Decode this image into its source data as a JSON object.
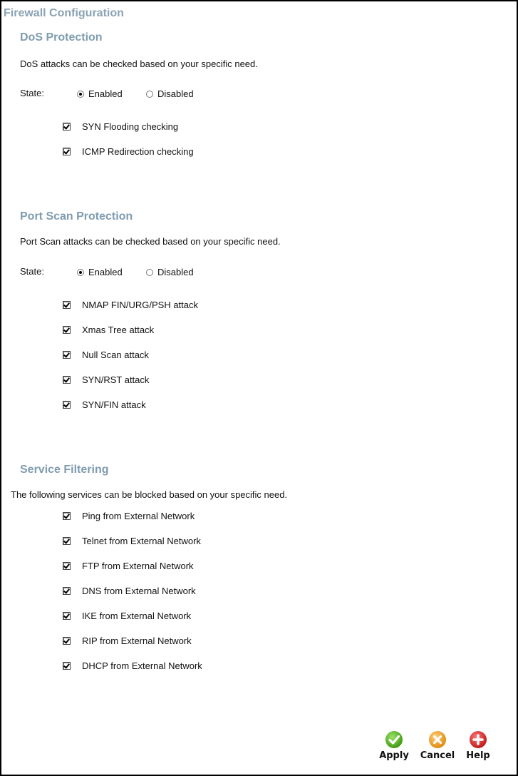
{
  "page_title": "Firewall Configuration",
  "dos": {
    "title": "DoS Protection",
    "description": "DoS attacks can be checked based on your specific need.",
    "state_label": "State:",
    "enabled_label": "Enabled",
    "disabled_label": "Disabled",
    "state": "Enabled",
    "items": [
      {
        "label": "SYN Flooding checking",
        "checked": true
      },
      {
        "label": "ICMP Redirection checking",
        "checked": true
      }
    ]
  },
  "portscan": {
    "title": "Port Scan Protection",
    "description": "Port Scan attacks can be checked based on your specific need.",
    "state_label": "State:",
    "enabled_label": "Enabled",
    "disabled_label": "Disabled",
    "state": "Enabled",
    "items": [
      {
        "label": "NMAP FIN/URG/PSH attack",
        "checked": true
      },
      {
        "label": "Xmas Tree attack",
        "checked": true
      },
      {
        "label": "Null Scan attack",
        "checked": true
      },
      {
        "label": "SYN/RST attack",
        "checked": true
      },
      {
        "label": "SYN/FIN attack",
        "checked": true
      }
    ]
  },
  "services": {
    "title": "Service Filtering",
    "description": "The following services can be blocked based on your specific need.",
    "items": [
      {
        "label": "Ping from External Network",
        "checked": true
      },
      {
        "label": "Telnet from External Network",
        "checked": true
      },
      {
        "label": "FTP from External Network",
        "checked": true
      },
      {
        "label": "DNS from External Network",
        "checked": true
      },
      {
        "label": "IKE from External Network",
        "checked": true
      },
      {
        "label": "RIP from External Network",
        "checked": true
      },
      {
        "label": "DHCP from External Network",
        "checked": true
      }
    ]
  },
  "buttons": {
    "apply_label": "Apply",
    "cancel_label": "Cancel",
    "help_label": "Help",
    "apply_color": "#4caf1e",
    "cancel_color": "#f0a020",
    "help_color": "#d62828"
  }
}
